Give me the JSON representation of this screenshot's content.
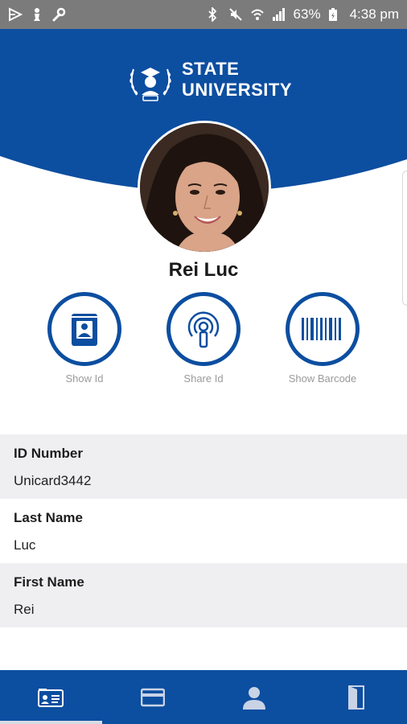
{
  "status_bar": {
    "battery_text": "63%",
    "time": "4:38 pm",
    "left_icons": [
      "video-icon",
      "chess-pawn-icon",
      "wrench-icon"
    ],
    "right_icons": [
      "bluetooth-icon",
      "mute-icon",
      "wifi-icon",
      "signal-icon",
      "battery-icon"
    ]
  },
  "header": {
    "logo_line1": "STATE",
    "logo_line2": "UNIVERSITY",
    "brand_color": "#0c4ea0"
  },
  "profile": {
    "name": "Rei Luc"
  },
  "actions": [
    {
      "label": "Show Id",
      "icon": "id-card-icon"
    },
    {
      "label": "Share Id",
      "icon": "broadcast-icon"
    },
    {
      "label": "Show Barcode",
      "icon": "barcode-icon"
    }
  ],
  "info_rows": [
    {
      "label": "ID Number",
      "value": "Unicard3442"
    },
    {
      "label": "Last Name",
      "value": "Luc"
    },
    {
      "label": "First Name",
      "value": "Rei"
    }
  ],
  "bottom_nav": [
    {
      "icon": "id-card-icon",
      "active": true
    },
    {
      "icon": "credit-card-icon",
      "active": false
    },
    {
      "icon": "person-icon",
      "active": false
    },
    {
      "icon": "exit-door-icon",
      "active": false
    }
  ]
}
